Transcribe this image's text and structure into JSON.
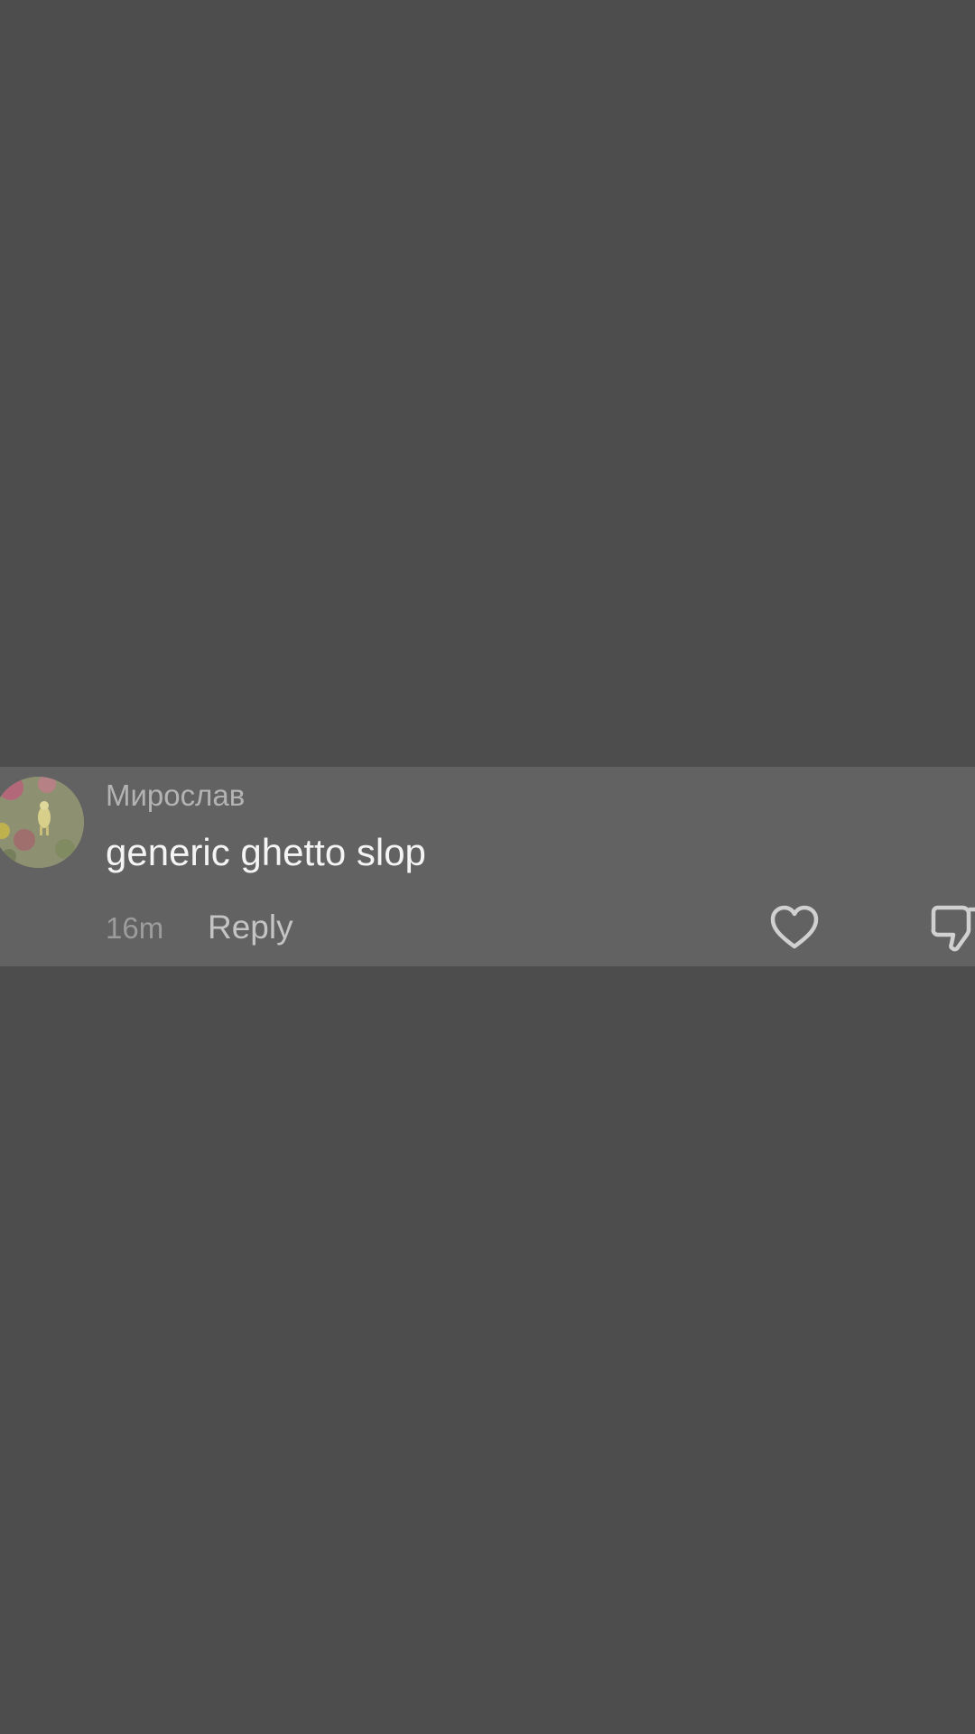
{
  "comment": {
    "username": "Мирослав",
    "text": "generic ghetto slop",
    "timestamp": "16m",
    "reply_label": "Reply",
    "avatar_icon": "avatar-image",
    "like_icon": "heart-outline-icon",
    "dislike_icon": "thumbs-down-outline-icon"
  },
  "colors": {
    "background": "#4d4d4d",
    "card_background": "#626262",
    "username": "#b3b3b3",
    "text": "#f4f4f4",
    "timestamp": "#9c9c9c",
    "reply": "#c4c4c4",
    "icon": "#d0d0d0"
  }
}
